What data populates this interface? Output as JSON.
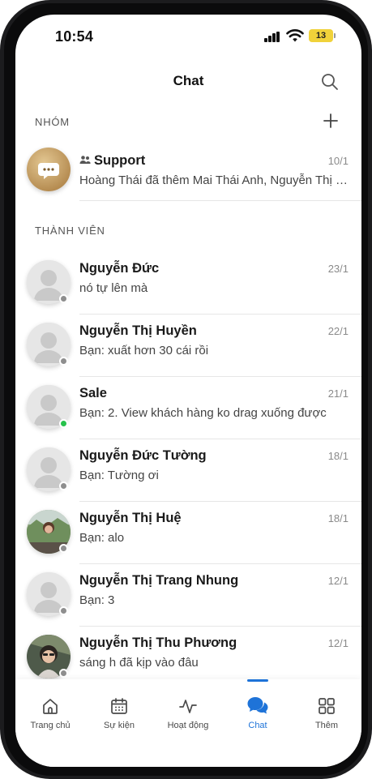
{
  "status_bar": {
    "time": "10:54",
    "battery": "13"
  },
  "header": {
    "title": "Chat",
    "search_icon": "search-icon"
  },
  "groups": {
    "section_title": "NHÓM",
    "add_icon": "plus-icon",
    "items": [
      {
        "name": "Support",
        "date": "10/1",
        "message": "Hoàng Thái đã thêm Mai Thái Anh, Nguyễn Thị Huyền"
      }
    ]
  },
  "members": {
    "section_title": "THÀNH VIÊN",
    "items": [
      {
        "name": "Nguyễn Đức",
        "date": "23/1",
        "message": "nó tự lên mà",
        "status": "offline",
        "avatar": "default"
      },
      {
        "name": "Nguyễn Thị Huyền",
        "date": "22/1",
        "message": "Bạn: xuất hơn 30 cái rồi",
        "status": "offline",
        "avatar": "default"
      },
      {
        "name": "Sale",
        "date": "21/1",
        "message": "Bạn: 2. View khách hàng ko drag xuống được",
        "status": "online",
        "avatar": "default"
      },
      {
        "name": "Nguyễn Đức Tường",
        "date": "18/1",
        "message": "Bạn: Tường ơi",
        "status": "offline",
        "avatar": "default"
      },
      {
        "name": "Nguyễn Thị Huệ",
        "date": "18/1",
        "message": "Bạn: alo",
        "status": "offline",
        "avatar": "photo"
      },
      {
        "name": "Nguyễn Thị Trang Nhung",
        "date": "12/1",
        "message": "Bạn: 3",
        "status": "offline",
        "avatar": "default"
      },
      {
        "name": "Nguyễn Thị Thu Phương",
        "date": "12/1",
        "message": "sáng h đã kịp vào đâu",
        "status": "offline",
        "avatar": "photo"
      }
    ]
  },
  "tabbar": {
    "active_color": "#1e73d8",
    "tabs": [
      {
        "label": "Trang chủ",
        "icon": "home-icon"
      },
      {
        "label": "Sự kiện",
        "icon": "calendar-icon"
      },
      {
        "label": "Hoạt động",
        "icon": "activity-icon"
      },
      {
        "label": "Chat",
        "icon": "chat-bubble-icon",
        "active": true
      },
      {
        "label": "Thêm",
        "icon": "grid-icon"
      }
    ]
  }
}
